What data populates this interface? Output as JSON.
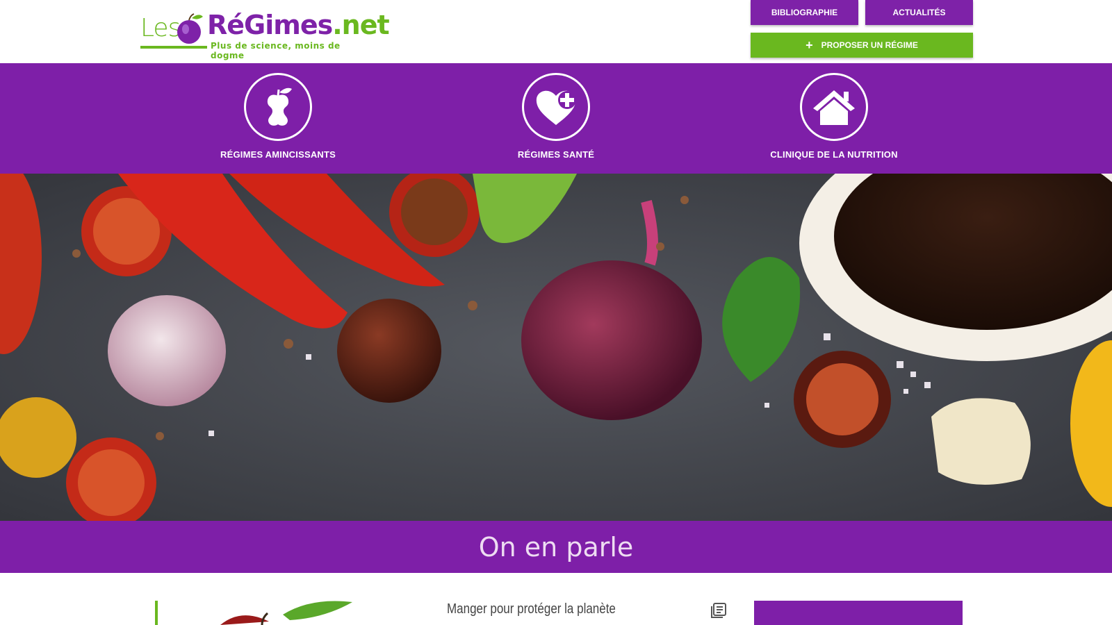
{
  "header": {
    "logo": {
      "les": "Les",
      "regimes": "RéGimes",
      "net": ".net",
      "tagline": "Plus de science, moins de dogme"
    },
    "buttons": {
      "bibliographie": "BIBLIOGRAPHIE",
      "actualites": "ACTUALITÉS",
      "proposer_plus": "+",
      "proposer": "PROPOSER UN RÉGIME"
    }
  },
  "categories": [
    {
      "label": "RÉGIMES AMINCISSANTS",
      "icon": "apple-core-icon"
    },
    {
      "label": "RÉGIMES SANTÉ",
      "icon": "heart-plus-icon"
    },
    {
      "label": "CLINIQUE DE LA NUTRITION",
      "icon": "house-icon"
    }
  ],
  "hero": {
    "description_icon": "vegetables-photo"
  },
  "section": {
    "title": "On en parle"
  },
  "article": {
    "title": "Manger pour protéger la planète",
    "icon": "news-list-icon"
  },
  "colors": {
    "purple": "#7e1fa8",
    "green": "#6ab81f",
    "white": "#ffffff"
  }
}
